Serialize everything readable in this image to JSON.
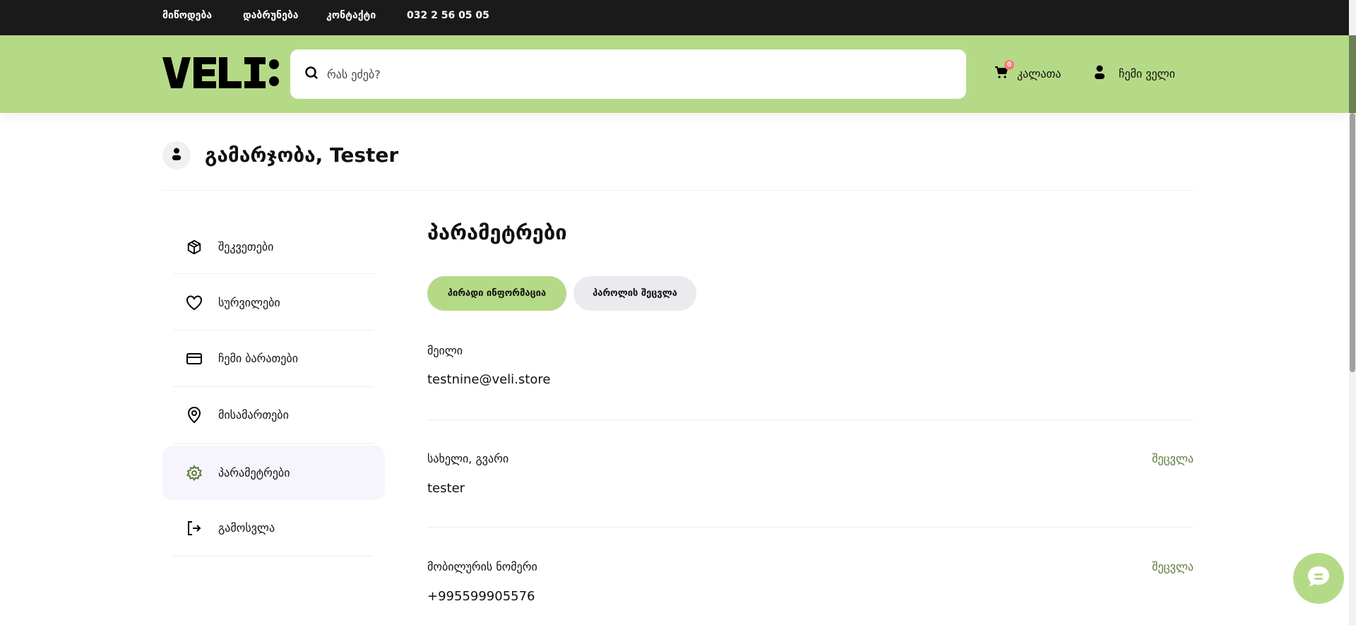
{
  "topbar": {
    "links": [
      "მიწოდება",
      "დაბრუნება",
      "კონტაქტი"
    ],
    "phone": "032 2 56 05 05"
  },
  "header": {
    "logo": "VELI:",
    "search_placeholder": "რას ეძებ?",
    "cart_label": "კალათა",
    "cart_count": "0",
    "account_label": "ჩემი ველი"
  },
  "greeting": "გამარჯობა, Tester",
  "sidebar": {
    "items": [
      {
        "label": "შეკვეთები",
        "icon": "box-icon"
      },
      {
        "label": "სურვილები",
        "icon": "heart-icon"
      },
      {
        "label": "ჩემი ბარათები",
        "icon": "card-icon"
      },
      {
        "label": "მისამართები",
        "icon": "location-icon"
      },
      {
        "label": "პარამეტრები",
        "icon": "gear-icon",
        "active": true
      },
      {
        "label": "გამოსვლა",
        "icon": "logout-icon"
      }
    ]
  },
  "main": {
    "title": "პარამეტრები",
    "tabs": [
      {
        "label": "პირადი ინფორმაცია",
        "active": true
      },
      {
        "label": "პაროლის შეცვლა"
      }
    ],
    "fields": [
      {
        "label": "მეილი",
        "value": "testnine@veli.store"
      },
      {
        "label": "სახელი, გვარი",
        "value": "tester",
        "edit": "შეცვლა"
      },
      {
        "label": "მობილურის ნომერი",
        "value": "+995599905576",
        "edit": "შეცვლა"
      }
    ]
  },
  "colors": {
    "brand": "#b5da87",
    "accent": "#5f7a3c",
    "topbar": "#1a1a1a",
    "badge": "#ff7777"
  }
}
